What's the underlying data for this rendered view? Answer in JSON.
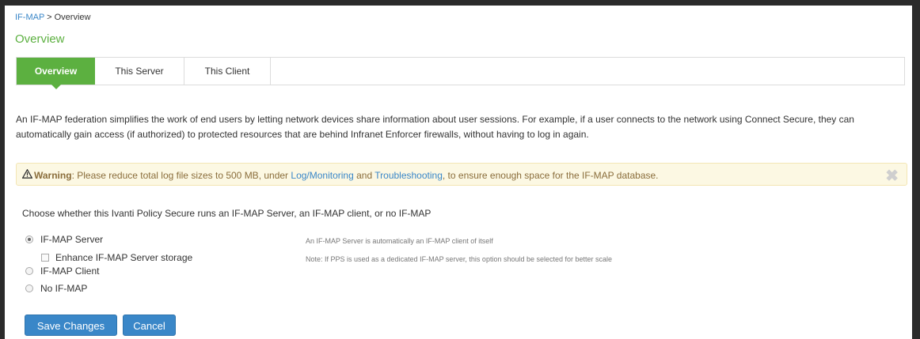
{
  "breadcrumb": {
    "link": "IF-MAP",
    "separator": " > ",
    "current": "Overview"
  },
  "page_title": "Overview",
  "tabs": [
    {
      "label": "Overview",
      "active": true
    },
    {
      "label": "This Server",
      "active": false
    },
    {
      "label": "This Client",
      "active": false
    }
  ],
  "description": "An IF-MAP federation simplifies the work of end users by letting network devices share information about user sessions. For example, if a user connects to the network using Connect Secure, they can automatically gain access (if authorized) to protected resources that are behind Infranet Enforcer firewalls, without having to log in again.",
  "warning": {
    "label": "Warning",
    "text_1": ":  Please reduce total log file sizes to 500 MB, under ",
    "link_1": "Log/Monitoring",
    "text_2": " and ",
    "link_2": "Troubleshooting",
    "text_3": ", to ensure enough space for the IF-MAP database."
  },
  "prompt": "Choose whether this Ivanti Policy Secure runs an IF-MAP Server, an IF-MAP client, or no IF-MAP",
  "options": {
    "server": {
      "label": "IF-MAP Server",
      "selected": true,
      "note": "An IF-MAP Server is automatically an IF-MAP client of itself"
    },
    "enhance": {
      "label": "Enhance IF-MAP Server storage",
      "checked": false,
      "note": "Note: If PPS is used as a dedicated IF-MAP server, this option should be selected for better scale"
    },
    "client": {
      "label": "IF-MAP Client",
      "selected": false
    },
    "none": {
      "label": "No IF-MAP",
      "selected": false
    }
  },
  "buttons": {
    "save": "Save Changes",
    "cancel": "Cancel"
  },
  "colors": {
    "accent_green": "#5cb040",
    "link_blue": "#3a87c8",
    "warning_bg": "#fcf8e3",
    "button_blue": "#3a87c8"
  }
}
